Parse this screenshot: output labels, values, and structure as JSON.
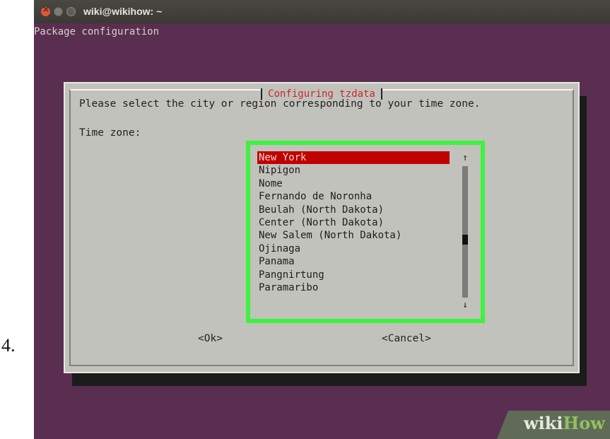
{
  "step_number": "4.",
  "window": {
    "title": "wiki@wikihow: ~",
    "terminal_header": "Package configuration"
  },
  "dialog": {
    "title": "Configuring tzdata",
    "prompt": "Please select the city or region corresponding to your time zone.",
    "field_label": "Time zone:",
    "list": {
      "items": [
        "New York",
        "Nipigon",
        "Nome",
        "Fernando de Noronha",
        "Beulah (North Dakota)",
        "Center (North Dakota)",
        "New Salem (North Dakota)",
        "Ojinaga",
        "Panama",
        "Pangnirtung",
        "Paramaribo"
      ],
      "selected": "New York",
      "scroll_up": "↑",
      "scroll_down": "↓"
    },
    "ok_label": "<Ok>",
    "cancel_label": "<Cancel>"
  },
  "watermark": {
    "wiki": "wiki",
    "how": "How"
  },
  "colors": {
    "terminal_bg": "#5a2e50",
    "dialog_bg": "#c2c2bd",
    "selection": "#c00000",
    "highlight": "#3ff23f",
    "title_red": "#c62828"
  }
}
